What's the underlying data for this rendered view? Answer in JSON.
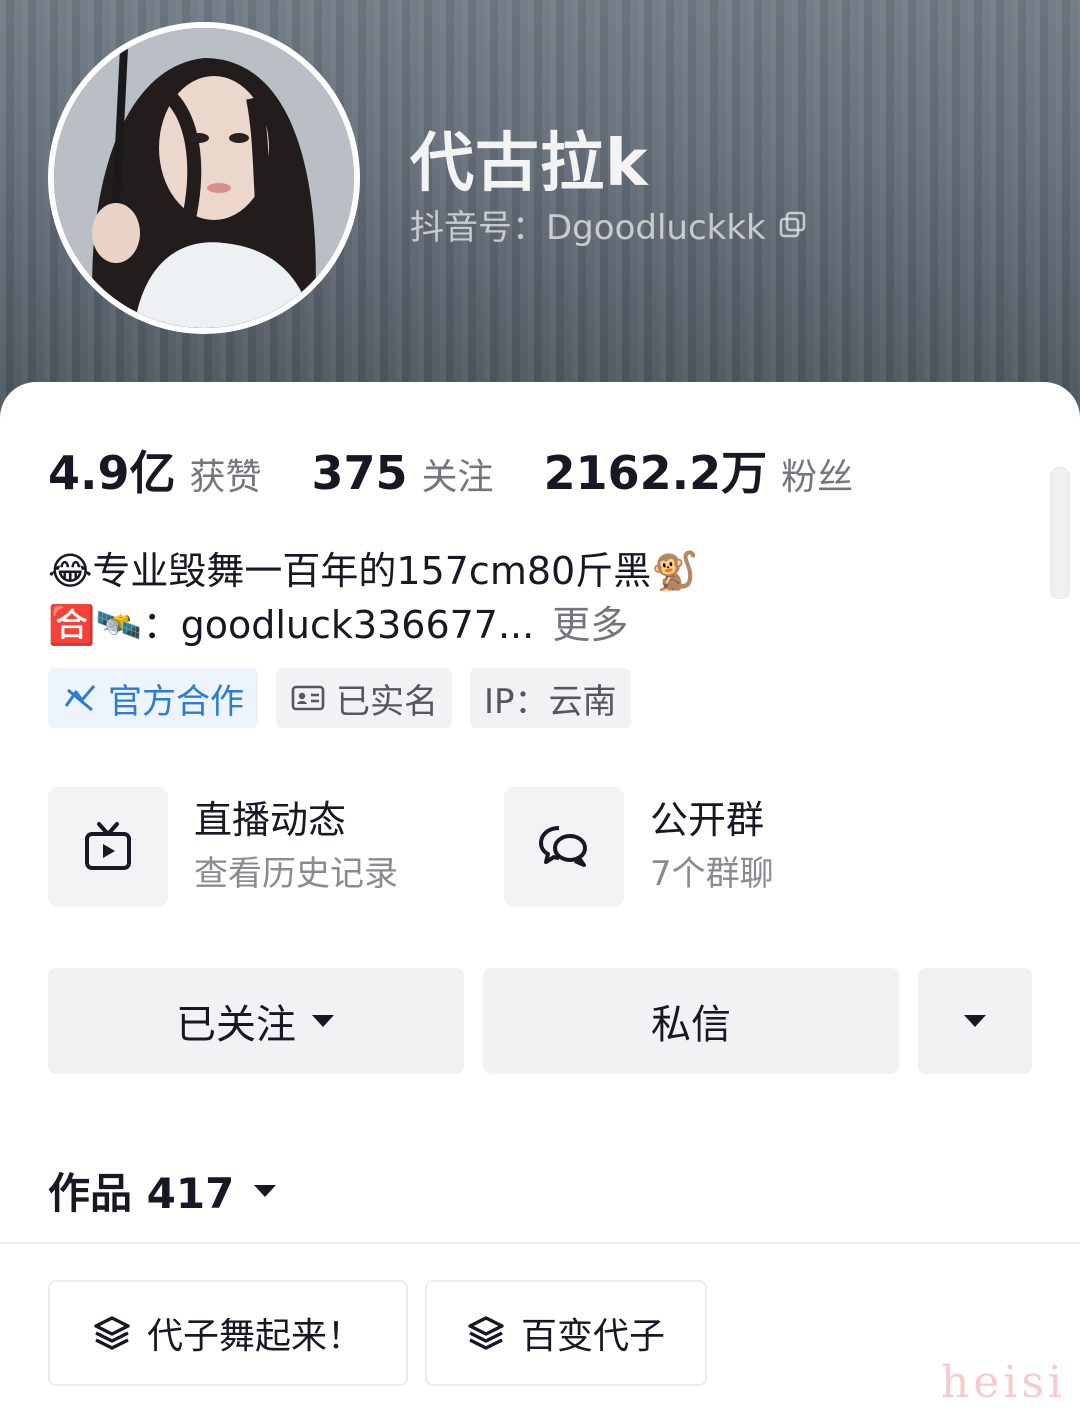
{
  "profile": {
    "nickname": "代古拉k",
    "douyin_id": "抖音号：Dgoodluckkk"
  },
  "stats": [
    {
      "value": "4.9亿",
      "label": "获赞"
    },
    {
      "value": "375",
      "label": "关注"
    },
    {
      "value": "2162.2万",
      "label": "粉丝"
    }
  ],
  "bio": {
    "line1": "😂专业毁舞一百年的157cm80斤黑🐒",
    "line2": "🈴🛰️：goodluck336677...",
    "more": "更多"
  },
  "tags": {
    "official": "官方合作",
    "verified": "已实名",
    "ip": "IP：云南"
  },
  "features": {
    "live": {
      "title": "直播动态",
      "subtitle": "查看历史记录"
    },
    "group": {
      "title": "公开群",
      "subtitle": "7个群聊"
    }
  },
  "actions": {
    "follow": "已关注",
    "message": "私信"
  },
  "works": {
    "label": "作品 417"
  },
  "collections": [
    "代子舞起来！",
    "百变代子"
  ],
  "watermark": "heisi",
  "colors": {
    "text_primary": "#161823",
    "text_secondary": "#75757d",
    "official_blue": "#2a7cd6",
    "button_bg": "#f2f2f4"
  }
}
